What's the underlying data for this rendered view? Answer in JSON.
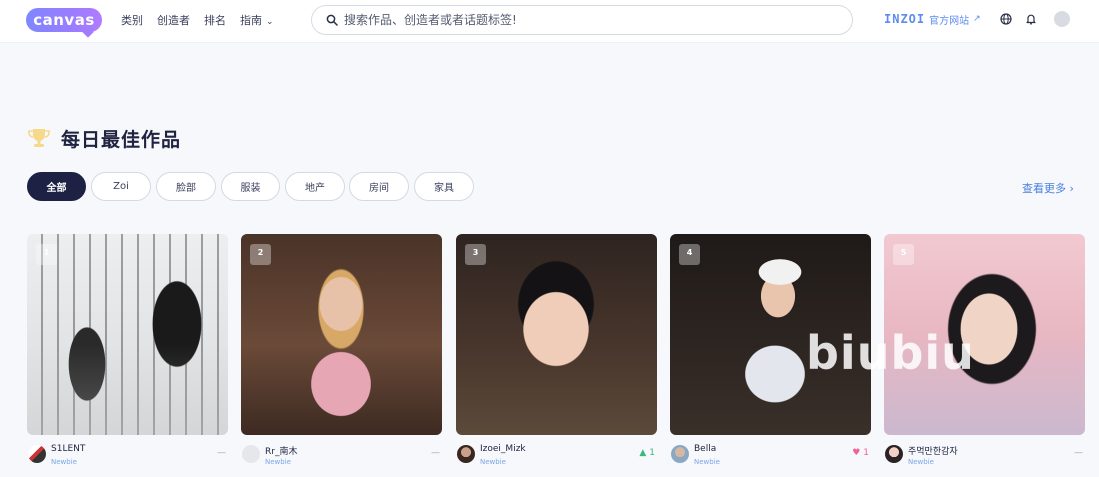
{
  "header": {
    "logo": "canvas",
    "nav": [
      "类别",
      "创造者",
      "排名",
      "指南"
    ],
    "search_placeholder": "搜索作品、创造者或者话题标签!",
    "brand_word": "INZOI",
    "brand_link": "官方网站"
  },
  "section": {
    "title": "每日最佳作品",
    "filters": [
      "全部",
      "Zoi",
      "脸部",
      "服装",
      "地产",
      "房间",
      "家具"
    ],
    "active_filter": "全部",
    "see_more": "查看更多"
  },
  "cards": [
    {
      "rank": "1",
      "author": "S1LENT",
      "level": "Newbie",
      "meta": "—"
    },
    {
      "rank": "2",
      "author": "Rr_南木",
      "level": "Newbie",
      "meta": "—"
    },
    {
      "rank": "3",
      "author": "Izoei_Mizk",
      "level": "Newbie",
      "meta": "1"
    },
    {
      "rank": "4",
      "author": "Bella",
      "level": "Newbie",
      "meta": "1"
    },
    {
      "rank": "5",
      "author": "주먹만한감자",
      "level": "Newbie",
      "meta": "—"
    }
  ],
  "watermark": "biubiu",
  "colors": {
    "accent": "#4a7fe0",
    "active_chip": "#1d2144",
    "background": "#f6f8fb"
  }
}
